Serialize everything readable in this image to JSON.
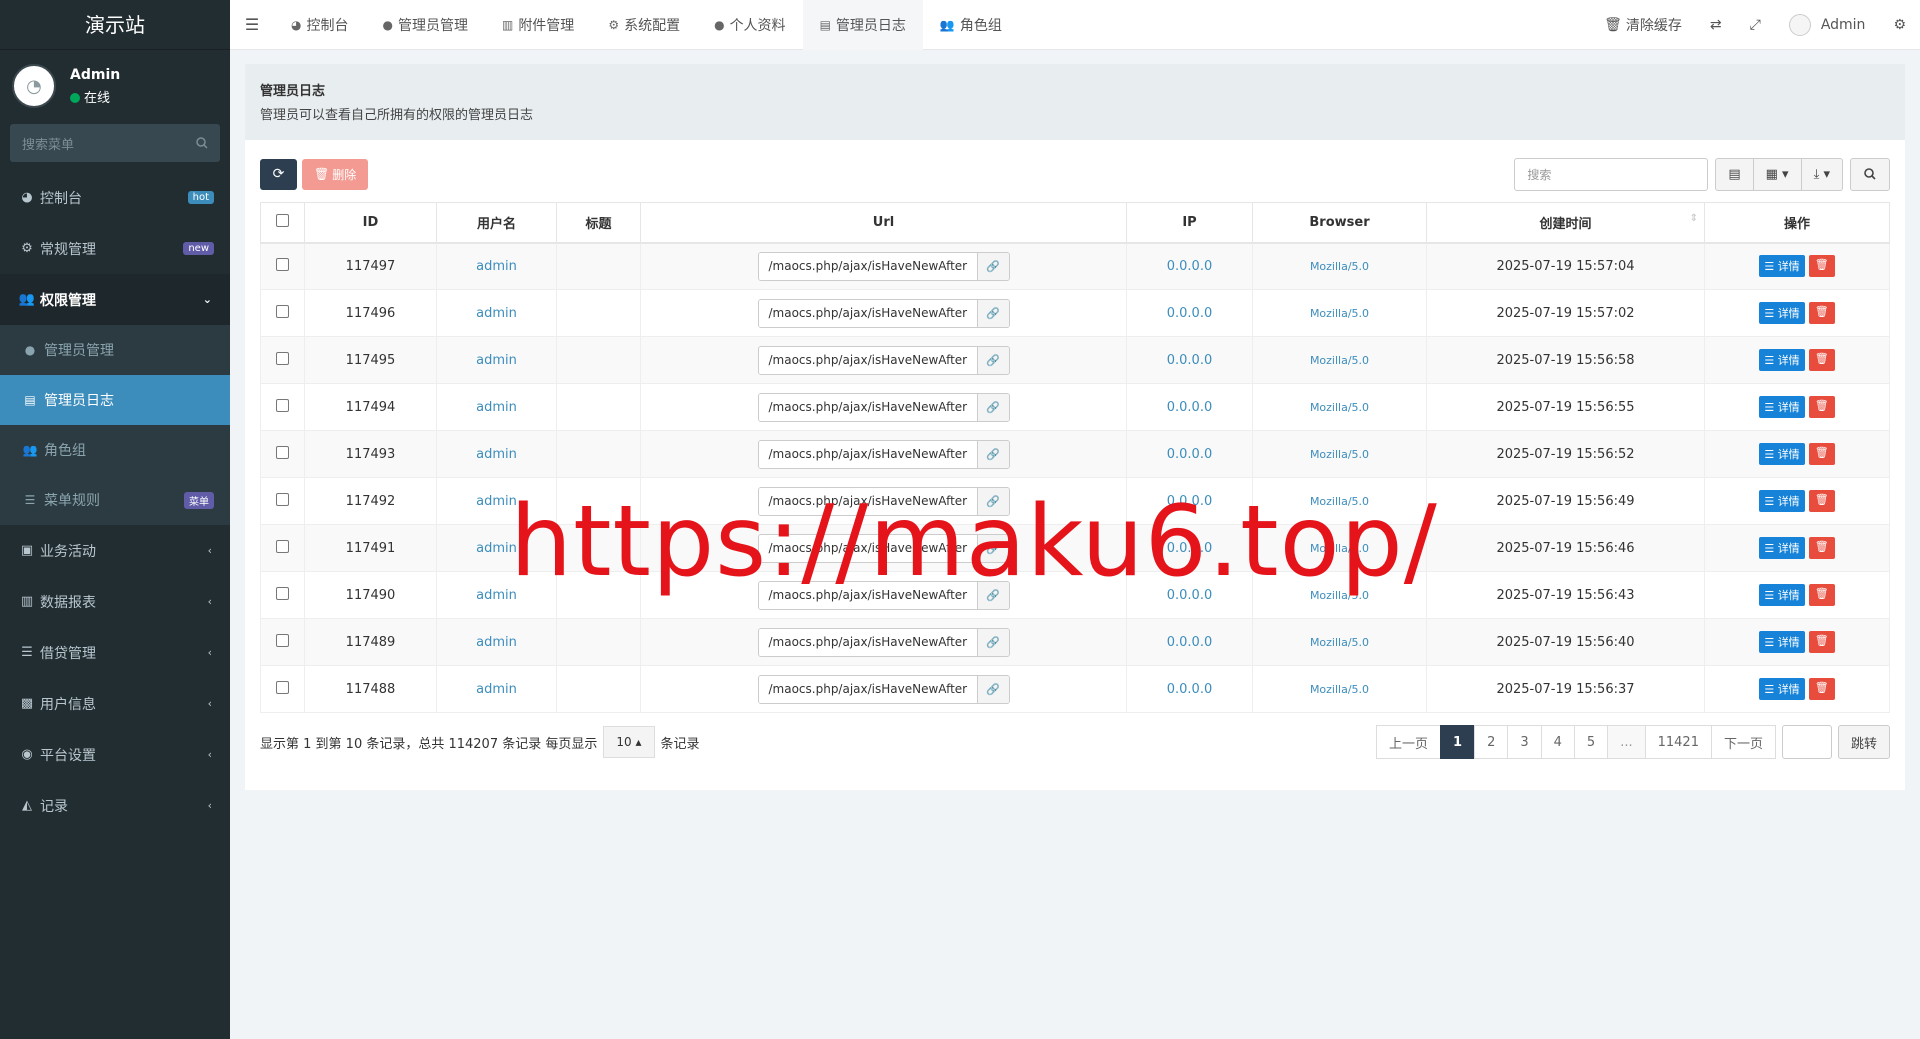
{
  "sidebar": {
    "logo": "演示站",
    "user": {
      "name": "Admin",
      "status": "在线"
    },
    "search_placeholder": "搜索菜单",
    "menu": [
      {
        "label": "控制台",
        "badge": "hot",
        "badge_color": "#3c8dbc"
      },
      {
        "label": "常规管理",
        "badge": "new",
        "badge_color": "#605ca8"
      },
      {
        "label": "权限管理",
        "open": true
      }
    ],
    "submenu": [
      {
        "label": "管理员管理"
      },
      {
        "label": "管理员日志",
        "active": true
      },
      {
        "label": "角色组"
      },
      {
        "label": "菜单规则",
        "badge": "菜单"
      }
    ],
    "menu2": [
      {
        "label": "业务活动"
      },
      {
        "label": "数据报表"
      },
      {
        "label": "借贷管理"
      },
      {
        "label": "用户信息"
      },
      {
        "label": "平台设置"
      },
      {
        "label": "记录"
      }
    ]
  },
  "topbar": {
    "tabs": [
      {
        "label": "控制台",
        "icon": "dashboard-icon"
      },
      {
        "label": "管理员管理",
        "icon": "user-icon"
      },
      {
        "label": "附件管理",
        "icon": "file-icon"
      },
      {
        "label": "系统配置",
        "icon": "gear-icon"
      },
      {
        "label": "个人资料",
        "icon": "user-icon"
      },
      {
        "label": "管理员日志",
        "icon": "list-icon",
        "active": true
      },
      {
        "label": "角色组",
        "icon": "group-icon"
      }
    ],
    "clear_cache": "清除缓存",
    "user": "Admin"
  },
  "panel": {
    "title": "管理员日志",
    "description": "管理员可以查看自己所拥有的权限的管理员日志"
  },
  "toolbar": {
    "delete_label": "删除",
    "search_placeholder": "搜索"
  },
  "table": {
    "headers": [
      "ID",
      "用户名",
      "标题",
      "Url",
      "IP",
      "Browser",
      "创建时间",
      "操作"
    ],
    "rows": [
      {
        "id": "117497",
        "user": "admin",
        "title": "",
        "url": "/maocs.php/ajax/isHaveNewAfter",
        "ip": "0.0.0.0",
        "browser": "Mozilla/5.0",
        "time": "2025-07-19 15:57:04"
      },
      {
        "id": "117496",
        "user": "admin",
        "title": "",
        "url": "/maocs.php/ajax/isHaveNewAfter",
        "ip": "0.0.0.0",
        "browser": "Mozilla/5.0",
        "time": "2025-07-19 15:57:02"
      },
      {
        "id": "117495",
        "user": "admin",
        "title": "",
        "url": "/maocs.php/ajax/isHaveNewAfter",
        "ip": "0.0.0.0",
        "browser": "Mozilla/5.0",
        "time": "2025-07-19 15:56:58"
      },
      {
        "id": "117494",
        "user": "admin",
        "title": "",
        "url": "/maocs.php/ajax/isHaveNewAfter",
        "ip": "0.0.0.0",
        "browser": "Mozilla/5.0",
        "time": "2025-07-19 15:56:55"
      },
      {
        "id": "117493",
        "user": "admin",
        "title": "",
        "url": "/maocs.php/ajax/isHaveNewAfter",
        "ip": "0.0.0.0",
        "browser": "Mozilla/5.0",
        "time": "2025-07-19 15:56:52"
      },
      {
        "id": "117492",
        "user": "admin",
        "title": "",
        "url": "/maocs.php/ajax/isHaveNewAfter",
        "ip": "0.0.0.0",
        "browser": "Mozilla/5.0",
        "time": "2025-07-19 15:56:49"
      },
      {
        "id": "117491",
        "user": "admin",
        "title": "",
        "url": "/maocs.php/ajax/isHaveNewAfter",
        "ip": "0.0.0.0",
        "browser": "Mozilla/5.0",
        "time": "2025-07-19 15:56:46"
      },
      {
        "id": "117490",
        "user": "admin",
        "title": "",
        "url": "/maocs.php/ajax/isHaveNewAfter",
        "ip": "0.0.0.0",
        "browser": "Mozilla/5.0",
        "time": "2025-07-19 15:56:43"
      },
      {
        "id": "117489",
        "user": "admin",
        "title": "",
        "url": "/maocs.php/ajax/isHaveNewAfter",
        "ip": "0.0.0.0",
        "browser": "Mozilla/5.0",
        "time": "2025-07-19 15:56:40"
      },
      {
        "id": "117488",
        "user": "admin",
        "title": "",
        "url": "/maocs.php/ajax/isHaveNewAfter",
        "ip": "0.0.0.0",
        "browser": "Mozilla/5.0",
        "time": "2025-07-19 15:56:37"
      }
    ],
    "detail_label": "详情"
  },
  "footer": {
    "summary": "显示第 1 到第 10 条记录，总共 114207 条记录 每页显示",
    "page_size": "10",
    "suffix": "条记录",
    "pager": [
      "上一页",
      "1",
      "2",
      "3",
      "4",
      "5",
      "...",
      "11421",
      "下一页"
    ],
    "current_page": "1",
    "jump_label": "跳转"
  },
  "watermark": "https://maku6.top/"
}
